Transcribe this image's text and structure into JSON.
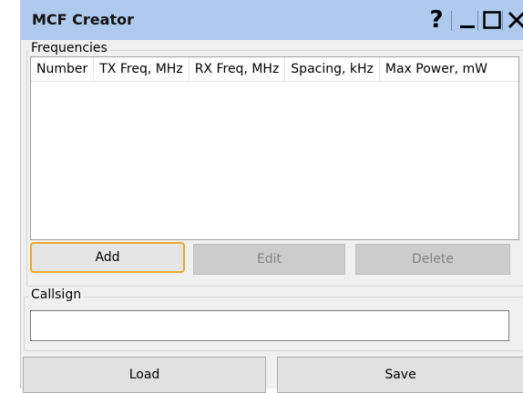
{
  "window": {
    "title": "MCF Creator",
    "help_label": "?"
  },
  "frequencies": {
    "group_label": "Frequencies",
    "columns": [
      "Number",
      "TX Freq, MHz",
      "RX Freq, MHz",
      "Spacing, kHz",
      "Max Power, mW"
    ],
    "rows": [],
    "add_label": "Add",
    "edit_label": "Edit",
    "delete_label": "Delete"
  },
  "callsign": {
    "group_label": "Callsign",
    "value": ""
  },
  "footer": {
    "load_label": "Load",
    "save_label": "Save"
  },
  "colors": {
    "titlebar": "#aecbee",
    "focus_border": "#f0a830",
    "window_bg": "#f0f0f0"
  },
  "icons": [
    "help-icon",
    "minimize-icon",
    "maximize-icon",
    "close-icon"
  ]
}
